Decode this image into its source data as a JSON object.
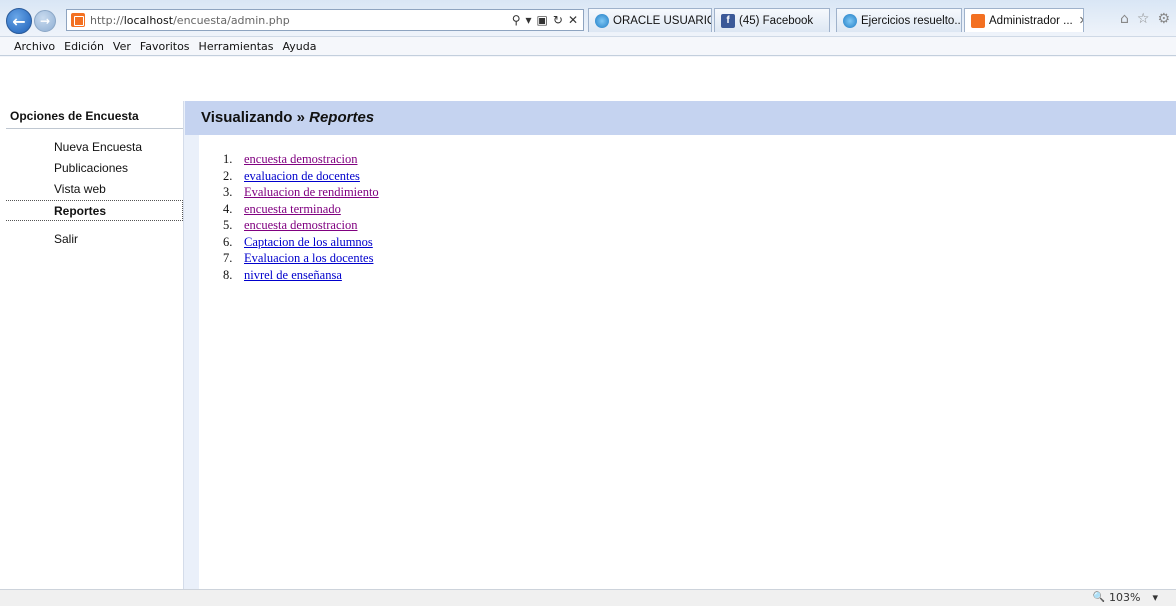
{
  "browser": {
    "url_prefix": "http://",
    "url_host": "localhost",
    "url_path": "/encuesta/admin.php",
    "tabs": [
      {
        "label": "ORACLE USUARIO...",
        "icon": "ie-icon"
      },
      {
        "label": "(45) Facebook",
        "icon": "facebook-icon"
      },
      {
        "label": "Ejercicios resuelto...",
        "icon": "ie-icon"
      },
      {
        "label": "Administrador ...",
        "icon": "xampp-icon",
        "active": true
      }
    ],
    "menu": [
      "Archivo",
      "Edición",
      "Ver",
      "Favoritos",
      "Herramientas",
      "Ayuda"
    ],
    "zoom": "103%"
  },
  "sidebar": {
    "title": "Opciones de Encuesta",
    "items": [
      {
        "label": "Nueva Encuesta"
      },
      {
        "label": "Publicaciones"
      },
      {
        "label": "Vista web"
      },
      {
        "label": "Reportes",
        "active": true
      },
      {
        "label": "Salir"
      }
    ]
  },
  "content": {
    "title_prefix": "Visualizando »",
    "title_section": "Reportes",
    "reports": [
      {
        "num": "1.",
        "label": "encuesta demostracion",
        "visited": true
      },
      {
        "num": "2.",
        "label": "evaluacion de docentes",
        "visited": false
      },
      {
        "num": "3.",
        "label": "Evaluacion de rendimiento",
        "visited": true
      },
      {
        "num": "4.",
        "label": "encuesta terminado",
        "visited": true
      },
      {
        "num": "5.",
        "label": "encuesta demostracion",
        "visited": true
      },
      {
        "num": "6.",
        "label": "Captacion de los alumnos",
        "visited": false
      },
      {
        "num": "7.",
        "label": "Evaluacion a los docentes",
        "visited": false
      },
      {
        "num": "8.",
        "label": "nivrel de enseñansa",
        "visited": false
      }
    ]
  },
  "colors": {
    "header_bg": "#c5d3f0",
    "visited_link": "#800080",
    "unvisited_link": "#0000cc"
  }
}
